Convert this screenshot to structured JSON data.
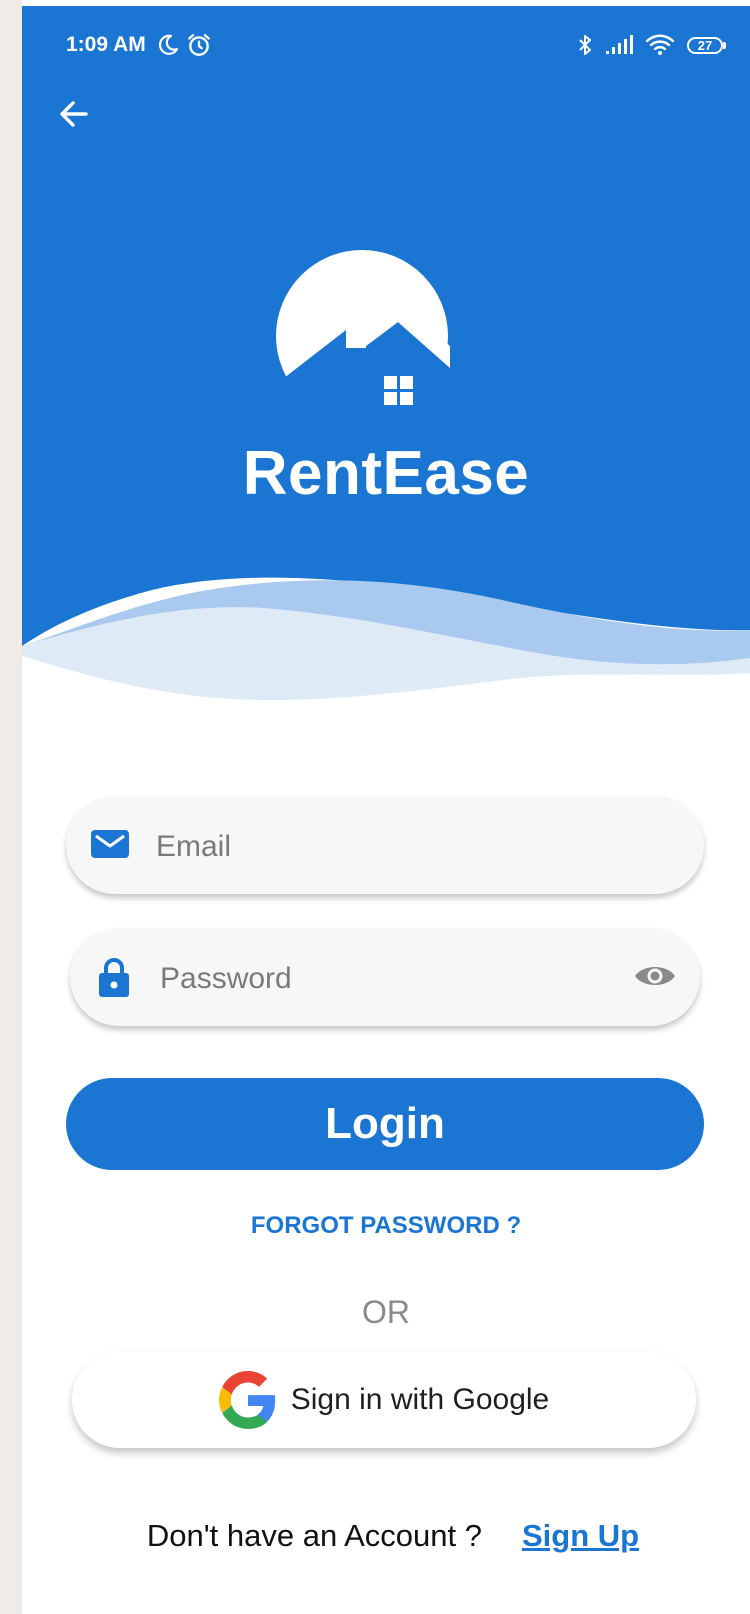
{
  "status_bar": {
    "time": "1:09 AM",
    "battery": "27",
    "icons": [
      "moon-icon",
      "alarm-icon",
      "bluetooth-icon",
      "signal-icon",
      "wifi-icon",
      "battery-icon"
    ]
  },
  "header": {
    "app_name": "RentEase",
    "back_icon": "arrow-left-icon",
    "logo_icon": "house-moon-logo"
  },
  "form": {
    "email_placeholder": "Email",
    "email_value": "",
    "password_placeholder": "Password",
    "password_value": "",
    "login_label": "Login",
    "forgot_label": "FORGOT PASSWORD ?",
    "or_label": "OR",
    "google_label": "Sign in with Google",
    "signup_prompt": "Don't have an Account ?",
    "signup_label": "Sign Up"
  },
  "colors": {
    "primary": "#1a76d2",
    "wave_light": "#dfeaf7",
    "wave_mid": "#aac9ef",
    "field_bg": "#f7f7f7"
  }
}
